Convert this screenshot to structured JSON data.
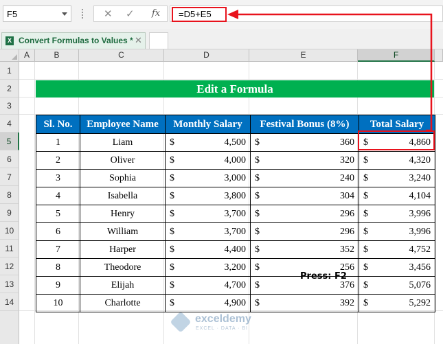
{
  "formula_bar": {
    "name_box": "F5",
    "cancel_icon": "✕",
    "enter_icon": "✓",
    "fx_label": "fx",
    "formula": "=D5+E5"
  },
  "sheet_tabs": {
    "active_tab": "Convert Formulas to Values *",
    "close_icon": "✕",
    "excel_icon_letter": "X"
  },
  "columns": [
    "A",
    "B",
    "C",
    "D",
    "E",
    "F"
  ],
  "selected_column": "F",
  "rows": [
    "1",
    "2",
    "3",
    "4",
    "5",
    "6",
    "7",
    "8",
    "9",
    "10",
    "11",
    "12",
    "13",
    "14"
  ],
  "selected_row": "5",
  "title": "Edit a Formula",
  "table": {
    "headers": [
      "Sl. No.",
      "Employee Name",
      "Monthly Salary",
      "Festival Bonus (8%)",
      "Total Salary"
    ],
    "currency": "$",
    "rows": [
      {
        "sl": "1",
        "name": "Liam",
        "monthly": "4,500",
        "bonus": "360",
        "total": "4,860"
      },
      {
        "sl": "2",
        "name": "Oliver",
        "monthly": "4,000",
        "bonus": "320",
        "total": "4,320"
      },
      {
        "sl": "3",
        "name": "Sophia",
        "monthly": "3,000",
        "bonus": "240",
        "total": "3,240"
      },
      {
        "sl": "4",
        "name": "Isabella",
        "monthly": "3,800",
        "bonus": "304",
        "total": "4,104"
      },
      {
        "sl": "5",
        "name": "Henry",
        "monthly": "3,700",
        "bonus": "296",
        "total": "3,996"
      },
      {
        "sl": "6",
        "name": "William",
        "monthly": "3,700",
        "bonus": "296",
        "total": "3,996"
      },
      {
        "sl": "7",
        "name": "Harper",
        "monthly": "4,400",
        "bonus": "352",
        "total": "4,752"
      },
      {
        "sl": "8",
        "name": "Theodore",
        "monthly": "3,200",
        "bonus": "256",
        "total": "3,456"
      },
      {
        "sl": "9",
        "name": "Elijah",
        "monthly": "4,700",
        "bonus": "376",
        "total": "5,076"
      },
      {
        "sl": "10",
        "name": "Charlotte",
        "monthly": "4,900",
        "bonus": "392",
        "total": "5,292"
      }
    ]
  },
  "annotation": "Press: F2",
  "watermark": {
    "name": "exceldemy",
    "tagline": "EXCEL · DATA · BI"
  },
  "colors": {
    "title_bg": "#00b050",
    "header_bg": "#0070c0",
    "highlight": "#e8121c",
    "excel_green": "#217346"
  }
}
